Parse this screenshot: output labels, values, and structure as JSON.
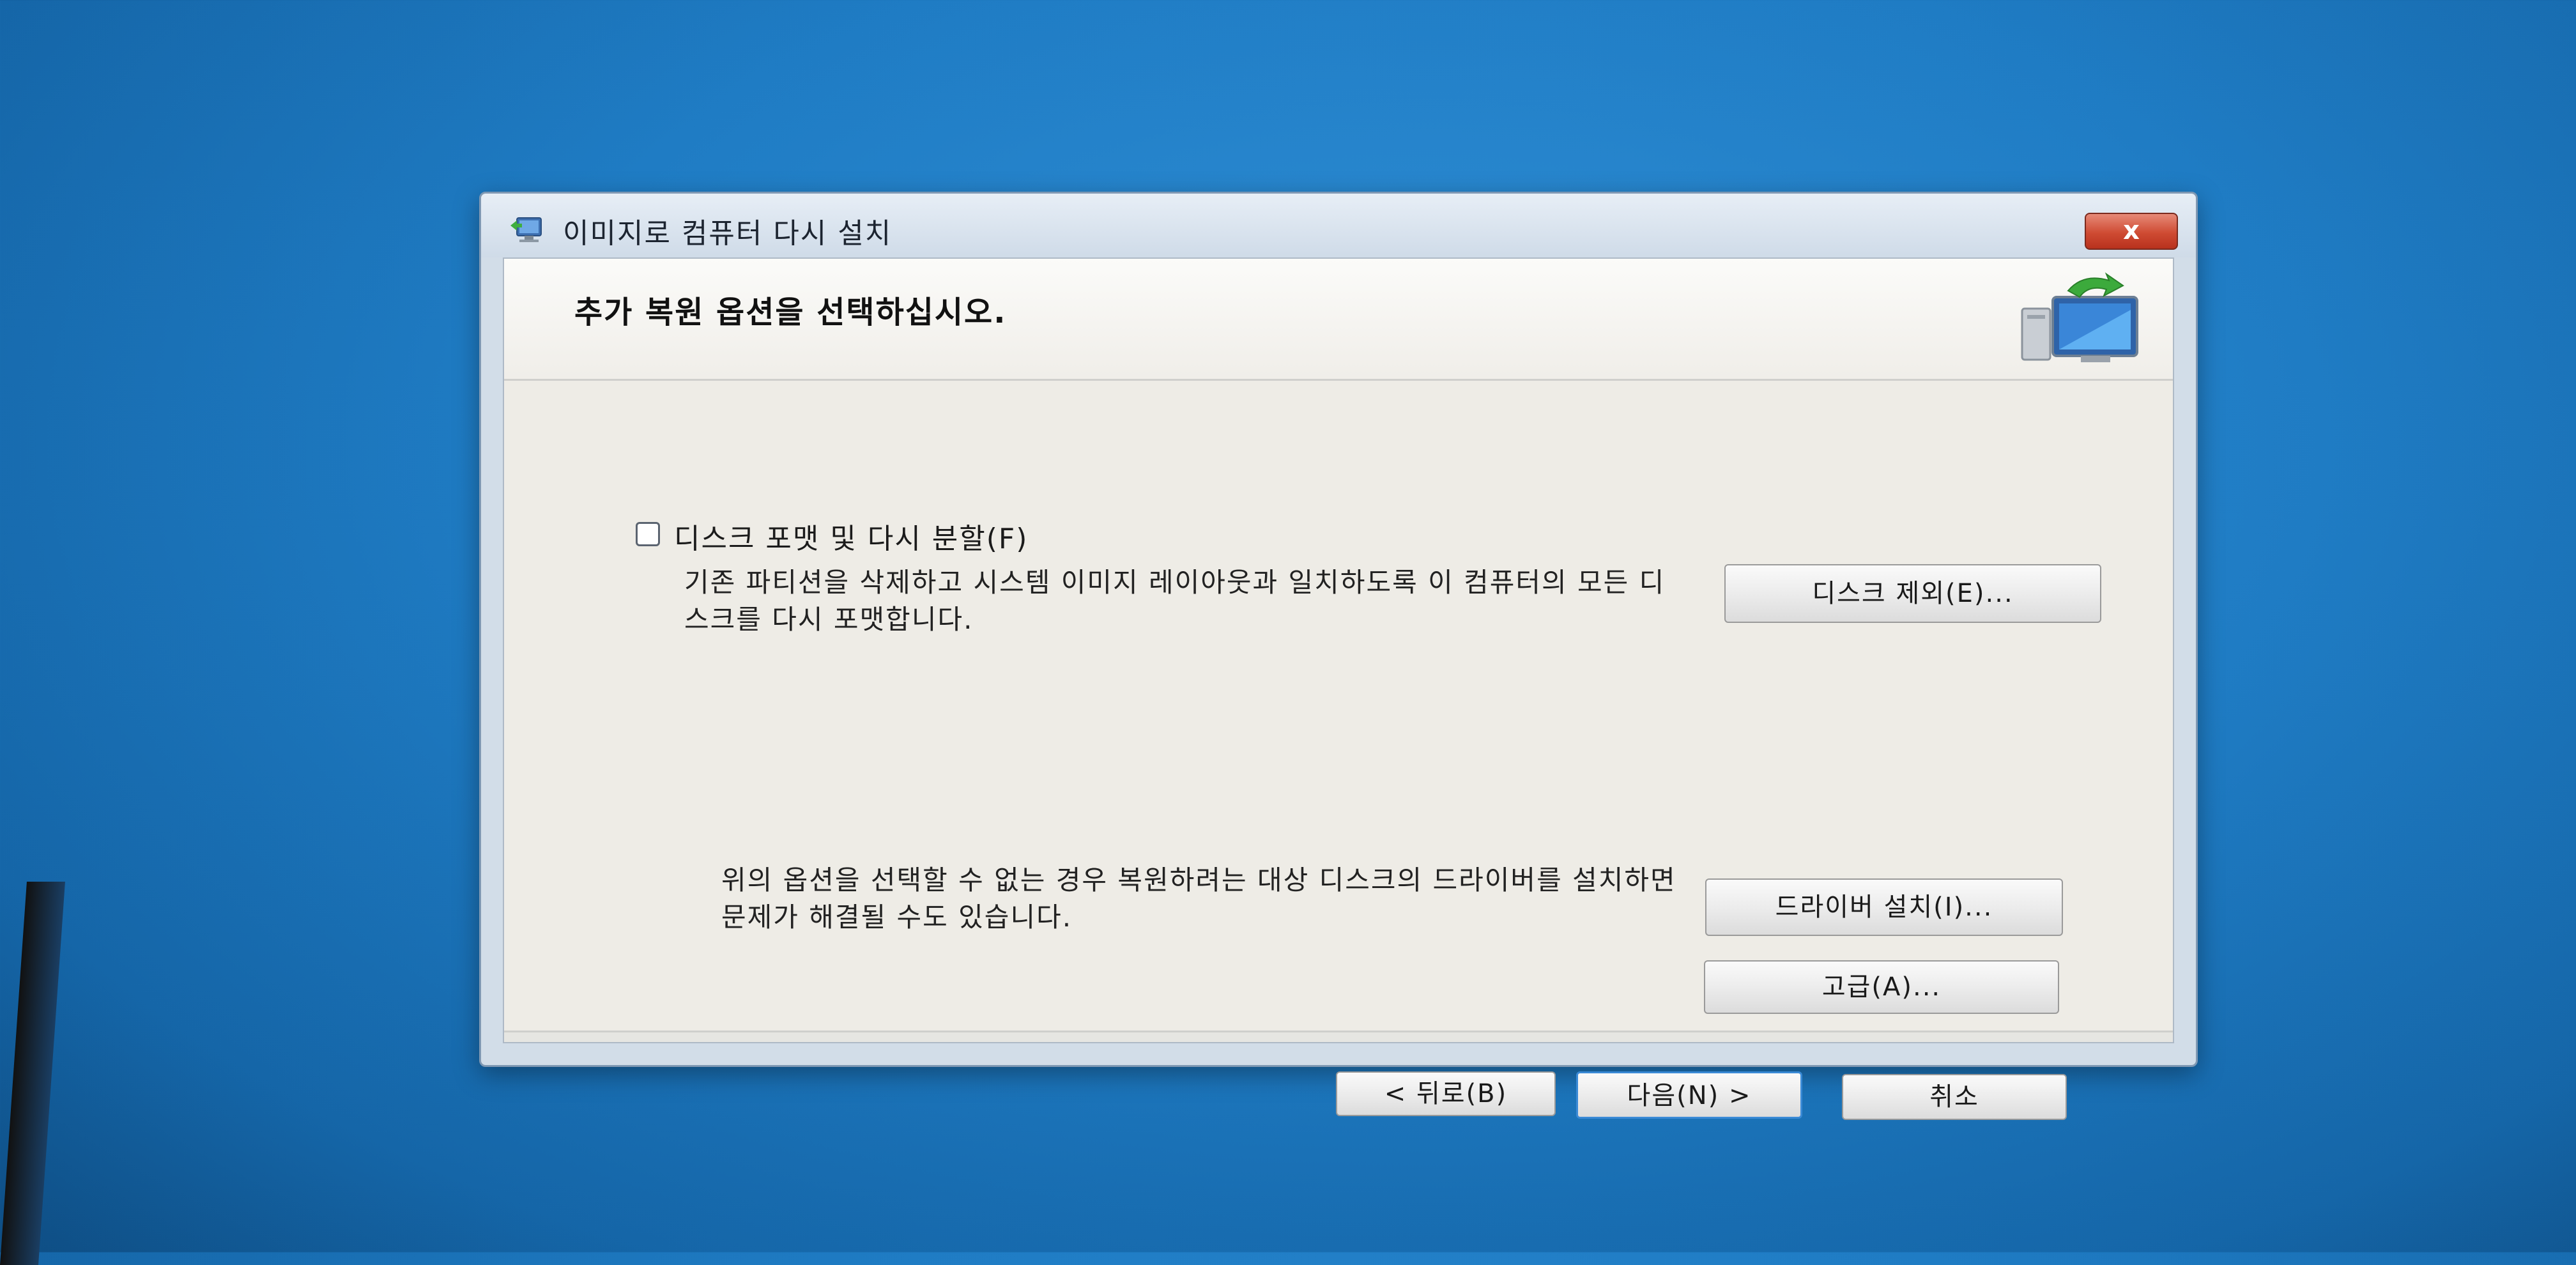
{
  "window": {
    "title": "이미지로 컴퓨터 다시 설치",
    "close_label": "x"
  },
  "header": {
    "title": "추가 복원 옵션을 선택하십시오."
  },
  "format_option": {
    "label": "디스크 포맷 및 다시 분할(F)",
    "description": "기존 파티션을 삭제하고 시스템 이미지 레이아웃과 일치하도록 이 컴퓨터의 모든 디스크를 다시 포맷합니다.",
    "checked": false
  },
  "buttons": {
    "exclude_disks": "디스크 제외(E)...",
    "install_drivers": "드라이버 설치(I)...",
    "advanced": "고급(A)...",
    "back": "< 뒤로(B)",
    "next": "다음(N) >",
    "cancel": "취소"
  },
  "driver_info": {
    "text": "위의 옵션을 선택할 수 없는 경우 복원하려는 대상 디스크의 드라이버를 설치하면 문제가 해결될 수도 있습니다."
  },
  "icons": {
    "title_icon": "restore-computer-icon",
    "header_icon": "monitor-restore-icon"
  },
  "colors": {
    "desktop": "#1f7cc4",
    "close_button": "#cf4b33",
    "default_button_border": "#3a8ad6"
  }
}
